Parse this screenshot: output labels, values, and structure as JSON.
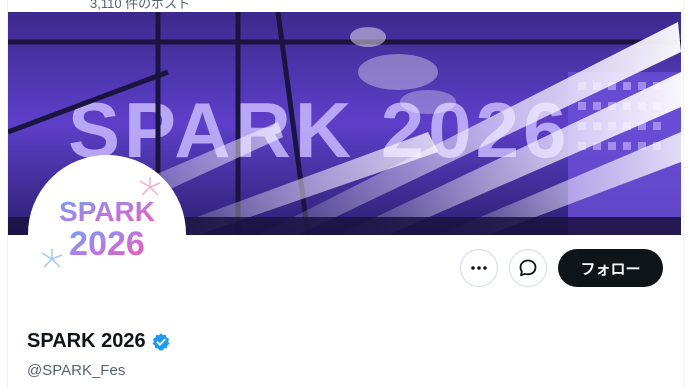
{
  "header": {
    "post_count": "3,110 件のポスト"
  },
  "banner": {
    "alt_text": "SPARK 2026"
  },
  "avatar": {
    "line1": "SPARK",
    "line2": "2026"
  },
  "actions": {
    "more_icon": "more-horizontal-icon",
    "message_icon": "message-icon",
    "follow_label": "フォロー"
  },
  "profile": {
    "display_name": "SPARK 2026",
    "handle": "@SPARK_Fes",
    "verified": true,
    "verified_color": "#1d9bf0"
  },
  "colors": {
    "accent_dark": "#0f1419",
    "muted_text": "#536471",
    "banner_purple": "#5b3bc4",
    "logo_pink": "#e455b5",
    "logo_blue": "#6aa7f0"
  }
}
